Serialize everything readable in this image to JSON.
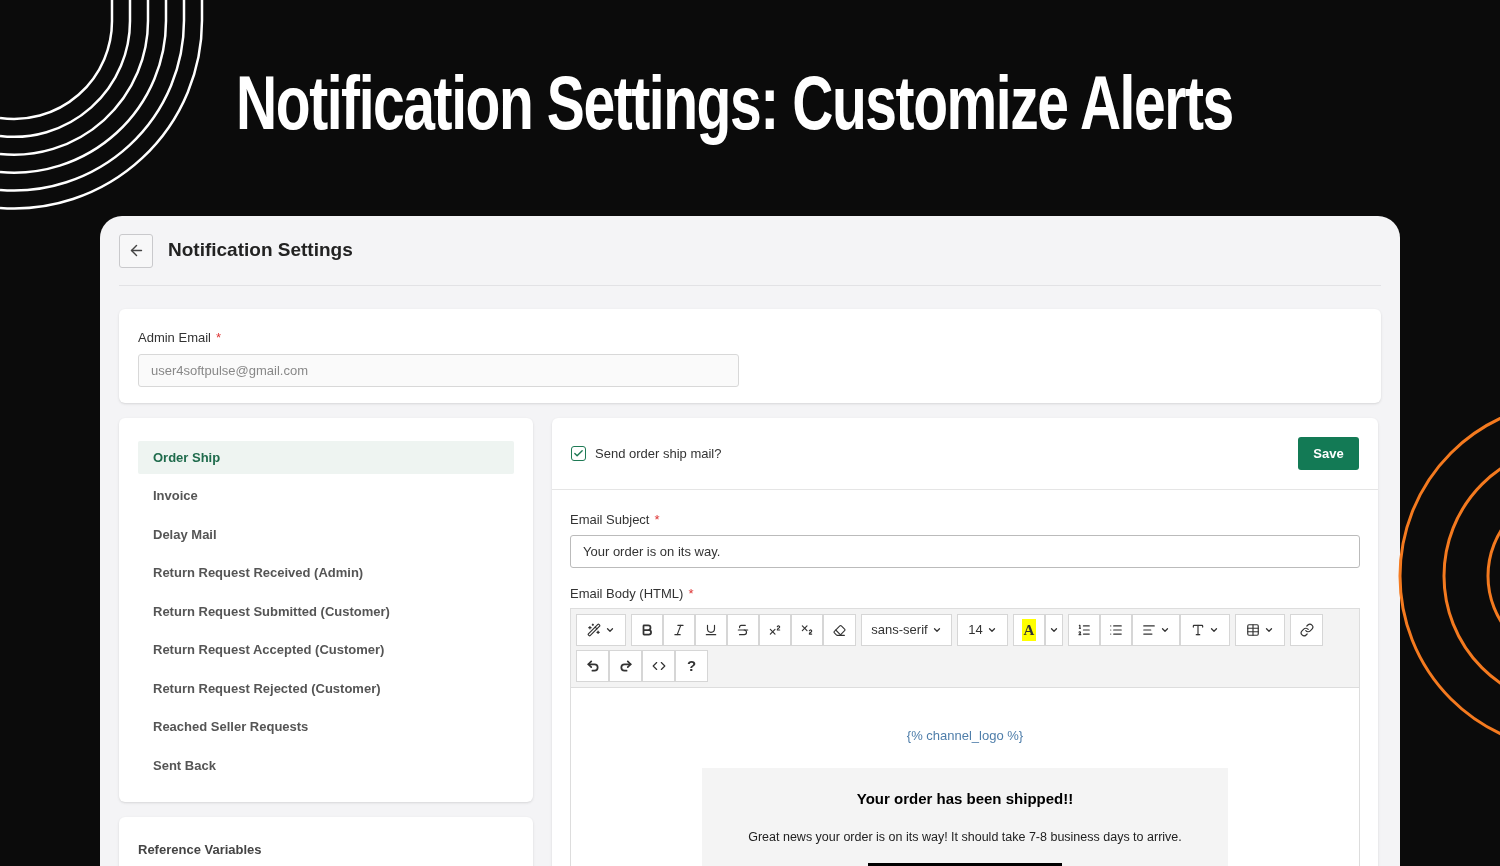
{
  "headline": "Notification Settings: Customize Alerts",
  "page": {
    "title": "Notification Settings",
    "admin_email": {
      "label": "Admin Email",
      "required_mark": "*",
      "value": "user4softpulse@gmail.com"
    },
    "templates": [
      {
        "label": "Order Ship",
        "selected": true
      },
      {
        "label": "Invoice",
        "selected": false
      },
      {
        "label": "Delay Mail",
        "selected": false
      },
      {
        "label": "Return Request Received (Admin)",
        "selected": false
      },
      {
        "label": "Return Request Submitted (Customer)",
        "selected": false
      },
      {
        "label": "Return Request Accepted (Customer)",
        "selected": false
      },
      {
        "label": "Return Request Rejected (Customer)",
        "selected": false
      },
      {
        "label": "Reached Seller Requests",
        "selected": false
      },
      {
        "label": "Sent Back",
        "selected": false
      }
    ],
    "reference_variables": {
      "title": "Reference Variables"
    },
    "editor": {
      "send_mail": {
        "label": "Send order ship mail?",
        "checked": true
      },
      "save": "Save",
      "subject": {
        "label": "Email Subject",
        "required_mark": "*",
        "value": "Your order is on its way."
      },
      "body_label": "Email Body (HTML)",
      "body_required_mark": "*",
      "toolbar": {
        "font": "sans-serif",
        "size": "14",
        "color_letter": "A",
        "help": "?"
      },
      "body": {
        "logo_placeholder": "{% channel_logo %}",
        "heading": "Your order has been shipped!!",
        "message": "Great news your order is on its way! It should take 7-8 business days to arrive."
      }
    }
  }
}
